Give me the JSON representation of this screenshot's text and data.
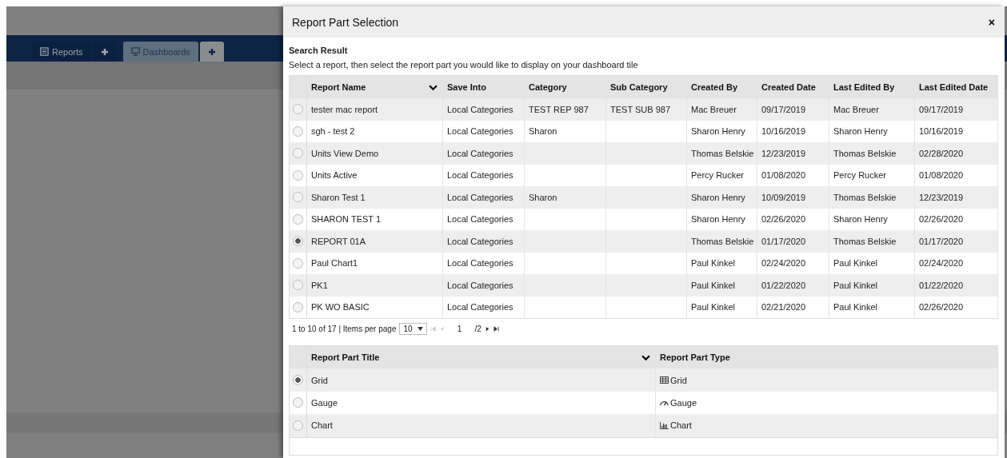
{
  "background": {
    "tabs": [
      {
        "label": "Reports",
        "selected": false
      },
      {
        "label": "Dashboards",
        "selected": true
      }
    ]
  },
  "dialog": {
    "title": "Report Part Selection",
    "close": "×",
    "section_title": "Search Result",
    "instruction": "Select a report, then select the report part you would like to display on your dashboard tile",
    "reports": {
      "columns": [
        "Report Name",
        "Save Into",
        "Category",
        "Sub Category",
        "Created By",
        "Created Date",
        "Last Edited By",
        "Last Edited Date"
      ],
      "rows": [
        {
          "selected": false,
          "cells": [
            "tester mac report",
            "Local Categories",
            "TEST REP 987",
            "TEST SUB 987",
            "Mac Breuer",
            "09/17/2019",
            "Mac Breuer",
            "09/17/2019"
          ]
        },
        {
          "selected": false,
          "cells": [
            "sgh - test 2",
            "Local Categories",
            "Sharon",
            null,
            "Sharon Henry",
            "10/16/2019",
            "Sharon Henry",
            "10/16/2019"
          ]
        },
        {
          "selected": false,
          "cells": [
            "Units View Demo",
            "Local Categories",
            null,
            null,
            "Thomas Belskie",
            "12/23/2019",
            "Thomas Belskie",
            "02/28/2020"
          ]
        },
        {
          "selected": false,
          "cells": [
            "Units Active",
            "Local Categories",
            null,
            null,
            "Percy Rucker",
            "01/08/2020",
            "Percy Rucker",
            "01/08/2020"
          ]
        },
        {
          "selected": false,
          "cells": [
            "Sharon Test 1",
            "Local Categories",
            "Sharon",
            null,
            "Sharon Henry",
            "10/09/2019",
            "Thomas Belskie",
            "12/23/2019"
          ]
        },
        {
          "selected": false,
          "cells": [
            "SHARON TEST 1",
            "Local Categories",
            null,
            null,
            "Sharon Henry",
            "02/26/2020",
            "Sharon Henry",
            "02/26/2020"
          ]
        },
        {
          "selected": true,
          "cells": [
            "REPORT 01A",
            "Local Categories",
            null,
            null,
            "Thomas Belskie",
            "01/17/2020",
            "Thomas Belskie",
            "01/17/2020"
          ]
        },
        {
          "selected": false,
          "cells": [
            "Paul Chart1",
            "Local Categories",
            null,
            null,
            "Paul Kinkel",
            "02/24/2020",
            "Paul Kinkel",
            "02/24/2020"
          ]
        },
        {
          "selected": false,
          "cells": [
            "PK1",
            "Local Categories",
            null,
            null,
            "Paul Kinkel",
            "01/22/2020",
            "Paul Kinkel",
            "01/22/2020"
          ]
        },
        {
          "selected": false,
          "cells": [
            "PK WO BASIC",
            "Local Categories",
            null,
            null,
            "Paul Kinkel",
            "02/21/2020",
            "Paul Kinkel",
            "02/26/2020"
          ]
        }
      ]
    },
    "pager": {
      "summary": "1 to 10 of 17 | Items per page",
      "page_size": "10",
      "page": "1",
      "total": "/2"
    },
    "parts": {
      "columns": [
        "Report Part Title",
        "Report Part Type"
      ],
      "rows": [
        {
          "selected": true,
          "title": "Grid",
          "type": "Grid",
          "kind": "grid"
        },
        {
          "selected": false,
          "title": "Gauge",
          "type": "Gauge",
          "kind": "gauge"
        },
        {
          "selected": false,
          "title": "Chart",
          "type": "Chart",
          "kind": "chart"
        }
      ]
    }
  }
}
